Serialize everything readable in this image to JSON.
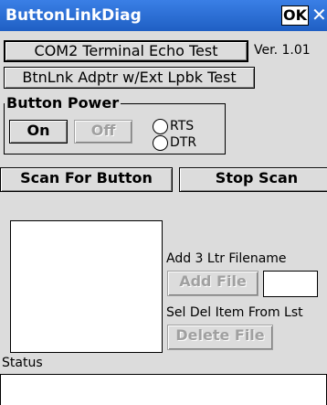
{
  "window": {
    "title": "ButtonLinkDiag",
    "ok_label": "OK",
    "close_label": "✕"
  },
  "toolbar": {
    "com2_test_label": "COM2 Terminal Echo Test",
    "version_text": "Ver. 1.01",
    "btnlnk_test_label": "BtnLnk Adptr w/Ext Lpbk Test"
  },
  "button_power": {
    "group_label": "Button Power",
    "on_label": "On",
    "off_label": "Off",
    "rts_label": "RTS",
    "dtr_label": "DTR"
  },
  "scan": {
    "scan_label": "Scan For Button",
    "stop_label": "Stop Scan"
  },
  "files": {
    "add_hint": "Add 3 Ltr Filename",
    "add_file_label": "Add File",
    "filename_value": "",
    "del_hint": "Sel Del Item From Lst",
    "delete_file_label": "Delete File"
  },
  "status": {
    "label": "Status",
    "value": ""
  },
  "colors": {
    "titlebar": "#2c6fd6",
    "client_bg": "#dcdcdc",
    "disabled_text": "#a0a0a0"
  }
}
